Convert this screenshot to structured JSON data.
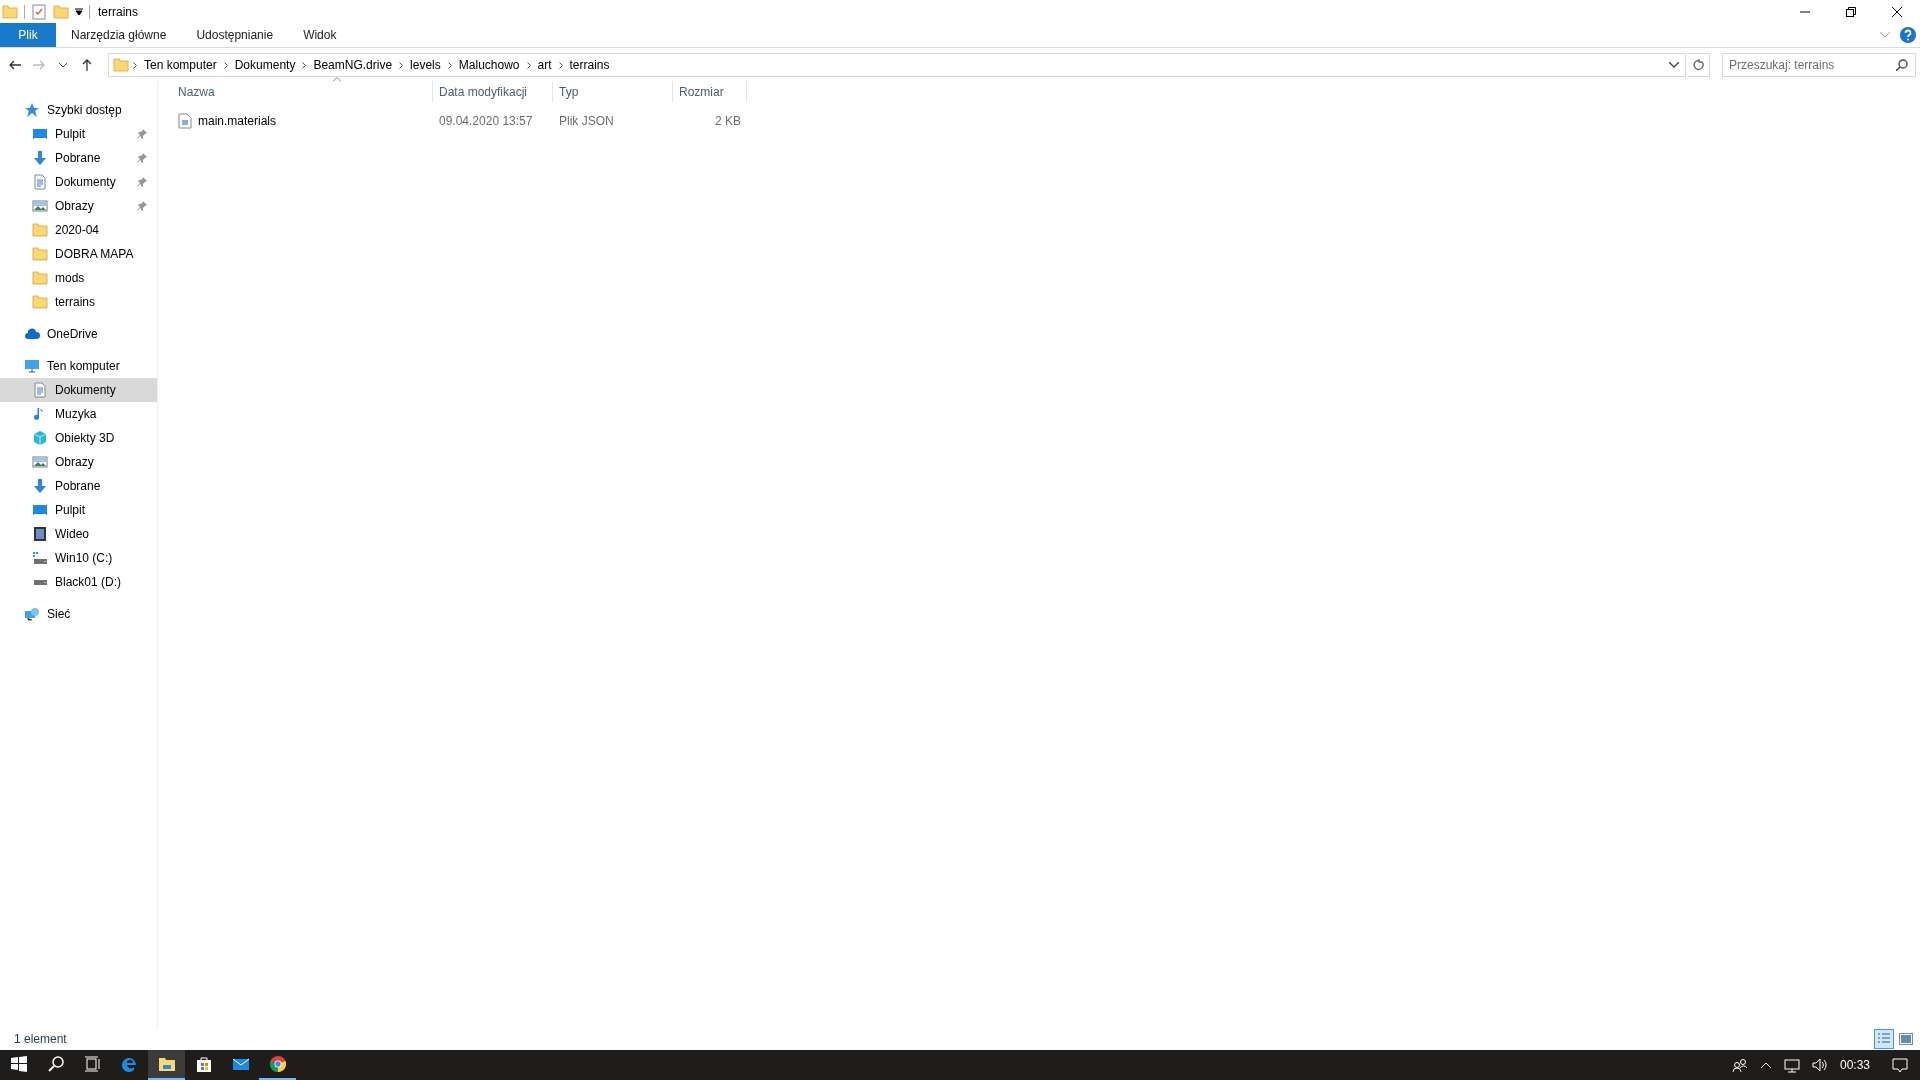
{
  "window": {
    "title": "terrains"
  },
  "ribbon": {
    "tabs": [
      {
        "label": "Plik",
        "kind": "file"
      },
      {
        "label": "Narzędzia główne",
        "kind": "tab"
      },
      {
        "label": "Udostępnianie",
        "kind": "tab"
      },
      {
        "label": "Widok",
        "kind": "tab"
      }
    ]
  },
  "address": {
    "crumbs": [
      "Ten komputer",
      "Dokumenty",
      "BeamNG.drive",
      "levels",
      "Maluchowo",
      "art",
      "terrains"
    ]
  },
  "search": {
    "placeholder": "Przeszukaj: terrains"
  },
  "sidebar": [
    {
      "label": "Szybki dostęp",
      "kind": "star",
      "selected": false,
      "children": [
        {
          "label": "Pulpit",
          "kind": "desktop",
          "pinned": true,
          "selected": false
        },
        {
          "label": "Pobrane",
          "kind": "download",
          "pinned": true,
          "selected": false
        },
        {
          "label": "Dokumenty",
          "kind": "document",
          "pinned": true,
          "selected": false
        },
        {
          "label": "Obrazy",
          "kind": "pictures",
          "pinned": true,
          "selected": false
        },
        {
          "label": "2020-04",
          "kind": "folder",
          "pinned": false,
          "selected": false
        },
        {
          "label": "DOBRA MAPA",
          "kind": "folder",
          "pinned": false,
          "selected": false
        },
        {
          "label": "mods",
          "kind": "folder",
          "pinned": false,
          "selected": false
        },
        {
          "label": "terrains",
          "kind": "folder",
          "pinned": false,
          "selected": false
        }
      ]
    },
    {
      "label": "OneDrive",
      "kind": "cloud",
      "selected": false
    },
    {
      "label": "Ten komputer",
      "kind": "computer",
      "selected": false,
      "children": [
        {
          "label": "Dokumenty",
          "kind": "document",
          "selected": true
        },
        {
          "label": "Muzyka",
          "kind": "music",
          "selected": false
        },
        {
          "label": "Obiekty 3D",
          "kind": "cube",
          "selected": false
        },
        {
          "label": "Obrazy",
          "kind": "pictures",
          "selected": false
        },
        {
          "label": "Pobrane",
          "kind": "download",
          "selected": false
        },
        {
          "label": "Pulpit",
          "kind": "desktop",
          "selected": false
        },
        {
          "label": "Wideo",
          "kind": "video",
          "selected": false
        },
        {
          "label": "Win10 (C:)",
          "kind": "system-drive",
          "selected": false
        },
        {
          "label": "Black01 (D:)",
          "kind": "drive",
          "selected": false
        }
      ]
    },
    {
      "label": "Sieć",
      "kind": "network",
      "selected": false
    }
  ],
  "columns": [
    {
      "label": "Nazwa",
      "sorted": true
    },
    {
      "label": "Data modyfikacji",
      "sorted": false
    },
    {
      "label": "Typ",
      "sorted": false
    },
    {
      "label": "Rozmiar",
      "sorted": false
    }
  ],
  "files": [
    {
      "name": "main.materials",
      "modified": "09.04.2020 13:57",
      "type": "Plik JSON",
      "size": "2 KB"
    }
  ],
  "status_bar": {
    "text": "1 element",
    "views": [
      {
        "kind": "details",
        "selected": true
      },
      {
        "kind": "large-icons",
        "selected": false
      }
    ]
  },
  "taskbar": {
    "apps": [
      {
        "kind": "start",
        "selected": false,
        "running": false
      },
      {
        "kind": "search",
        "selected": false,
        "running": false
      },
      {
        "kind": "task-view",
        "selected": false,
        "running": false
      },
      {
        "kind": "edge",
        "selected": false,
        "running": false
      },
      {
        "kind": "explorer",
        "selected": true,
        "running": true
      },
      {
        "kind": "store",
        "selected": false,
        "running": false
      },
      {
        "kind": "mail",
        "selected": false,
        "running": false
      },
      {
        "kind": "chrome",
        "selected": false,
        "running": true
      }
    ],
    "clock": "00:33"
  }
}
